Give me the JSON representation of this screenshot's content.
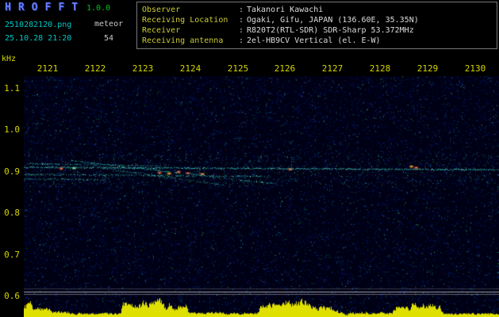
{
  "header": {
    "title_letters": [
      "H",
      "R",
      "O",
      "F",
      "F",
      "T"
    ],
    "version": "1.0.0",
    "filename": "2510282120.png",
    "mode": "meteor",
    "datetime": "25.10.28 21:20",
    "count": "54"
  },
  "info": {
    "separator": ":",
    "rows": [
      {
        "label": "Observer",
        "value": "Takanori Kawachi"
      },
      {
        "label": "Receiving Location",
        "value": "Ogaki, Gifu, JAPAN (136.60E, 35.35N)"
      },
      {
        "label": "Receiver",
        "value": "R820T2(RTL-SDR) SDR-Sharp 53.372MHz"
      },
      {
        "label": "Receiving antenna",
        "value": "2el-HB9CV Vertical (el. E-W)"
      }
    ]
  },
  "axes": {
    "y_unit": "kHz",
    "y_ticks": [
      "1.1",
      "1.0",
      "0.9",
      "0.8",
      "0.7",
      "0.6"
    ],
    "x_ticks": [
      "2121",
      "2122",
      "2123",
      "2124",
      "2125",
      "2126",
      "2127",
      "2128",
      "2129",
      "2130"
    ],
    "khz_top": 1.13,
    "khz_bottom": 0.552
  },
  "spectrogram": {
    "noise": {
      "bg": "#000014",
      "density": 0.085,
      "blues": [
        "#001a66",
        "#002299",
        "#0033cc",
        "#1144dd",
        "#001f8f"
      ],
      "brights": [
        "#00b8b8",
        "#00d0a0",
        "#33ddff",
        "#44ff88",
        "#7f7fff"
      ],
      "band_khz": [
        0.865,
        0.945
      ],
      "band_count": 700
    },
    "carrier_lines": [
      {
        "khz": 0.62,
        "color": "#9a9a9a",
        "alpha": 0.35
      },
      {
        "khz": 0.613,
        "color": "#c0c0c0",
        "alpha": 0.85
      },
      {
        "khz": 0.607,
        "color": "#8f8f8f",
        "alpha": 0.7
      }
    ],
    "traces": [
      {
        "name": "main-echo-trail",
        "x1": 0.0,
        "x2": 1.0,
        "khz1": 0.912,
        "khz2": 0.906,
        "color": "#44ddc8",
        "gap": 0.12
      },
      {
        "name": "lower-echo-trail",
        "x1": 0.0,
        "x2": 0.52,
        "khz1": 0.895,
        "khz2": 0.89,
        "color": "#2fbba6",
        "gap": 0.3
      },
      {
        "name": "drifting-trail-1",
        "x1": 0.1,
        "x2": 0.53,
        "khz1": 0.928,
        "khz2": 0.872,
        "color": "#2fc4ae",
        "gap": 0.38
      },
      {
        "name": "drifting-trail-2",
        "x1": 0.16,
        "x2": 0.42,
        "khz1": 0.91,
        "khz2": 0.87,
        "color": "#2aa896",
        "gap": 0.45
      },
      {
        "name": "short-trail-left",
        "x1": 0.0,
        "x2": 0.18,
        "khz1": 0.884,
        "khz2": 0.882,
        "color": "#2aa896",
        "gap": 0.4
      },
      {
        "name": "upper-faint-trail",
        "x1": 0.0,
        "x2": 0.3,
        "khz1": 0.921,
        "khz2": 0.915,
        "color": "#2aa8a0",
        "gap": 0.45
      }
    ],
    "hot_spots": [
      {
        "x": 0.078,
        "khz": 0.909,
        "color": "#ff5533"
      },
      {
        "x": 0.105,
        "khz": 0.91,
        "color": "#66ff99"
      },
      {
        "x": 0.285,
        "khz": 0.899,
        "color": "#ff5533"
      },
      {
        "x": 0.305,
        "khz": 0.897,
        "color": "#ffaa22"
      },
      {
        "x": 0.325,
        "khz": 0.901,
        "color": "#ff6644"
      },
      {
        "x": 0.345,
        "khz": 0.898,
        "color": "#dd4433"
      },
      {
        "x": 0.375,
        "khz": 0.896,
        "color": "#ff8833"
      },
      {
        "x": 0.56,
        "khz": 0.907,
        "color": "#ff7744"
      },
      {
        "x": 0.815,
        "khz": 0.914,
        "color": "#ffaa33"
      },
      {
        "x": 0.825,
        "khz": 0.911,
        "color": "#ff6633"
      }
    ],
    "activity": {
      "color": "#e0e000",
      "segments": [
        [
          0.0,
          0.015,
          6,
          22
        ],
        [
          0.015,
          0.055,
          5,
          14
        ],
        [
          0.055,
          0.095,
          3,
          9
        ],
        [
          0.095,
          0.205,
          2,
          6
        ],
        [
          0.205,
          0.25,
          8,
          22
        ],
        [
          0.25,
          0.295,
          10,
          26
        ],
        [
          0.295,
          0.345,
          6,
          16
        ],
        [
          0.345,
          0.495,
          2,
          7
        ],
        [
          0.495,
          0.545,
          8,
          20
        ],
        [
          0.545,
          0.6,
          10,
          26
        ],
        [
          0.6,
          0.66,
          6,
          18
        ],
        [
          0.66,
          0.775,
          2,
          7
        ],
        [
          0.775,
          0.815,
          6,
          16
        ],
        [
          0.815,
          0.875,
          8,
          20
        ],
        [
          0.875,
          1.0,
          2,
          6
        ]
      ]
    }
  }
}
